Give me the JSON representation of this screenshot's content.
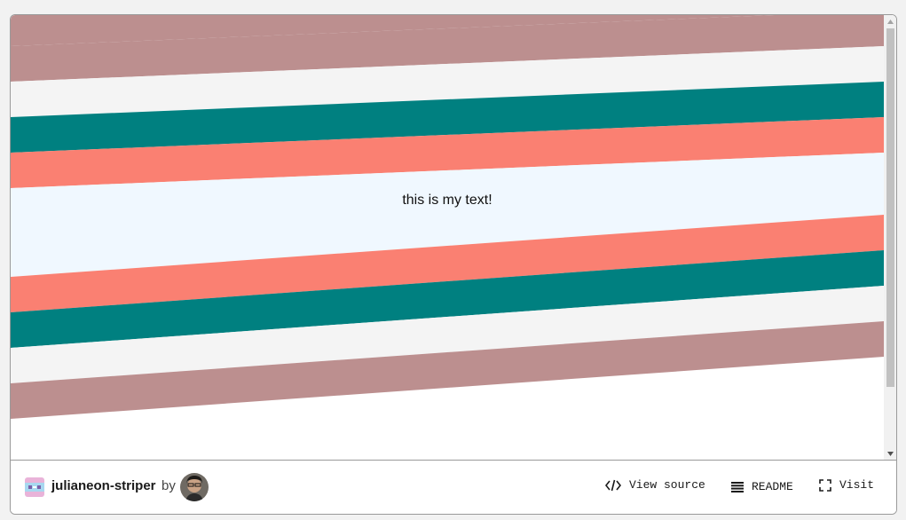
{
  "preview": {
    "text": "this is my text!",
    "colors": {
      "background": "#ffffff",
      "band_gray": "#f4f4f4",
      "band_rosy": "#bc8f8f",
      "band_teal": "#008080",
      "band_salmon": "#fa8072",
      "band_center": "#f0f8ff"
    }
  },
  "footer": {
    "project_name": "julianeon-striper",
    "by_label": "by",
    "actions": {
      "view_source": "View source",
      "readme": "README",
      "visit": "Visit"
    }
  },
  "icons": {
    "code": "code-icon",
    "readme": "list-icon",
    "visit": "fullscreen-icon",
    "scroll_up": "triangle-up-icon",
    "scroll_down": "triangle-down-icon"
  }
}
